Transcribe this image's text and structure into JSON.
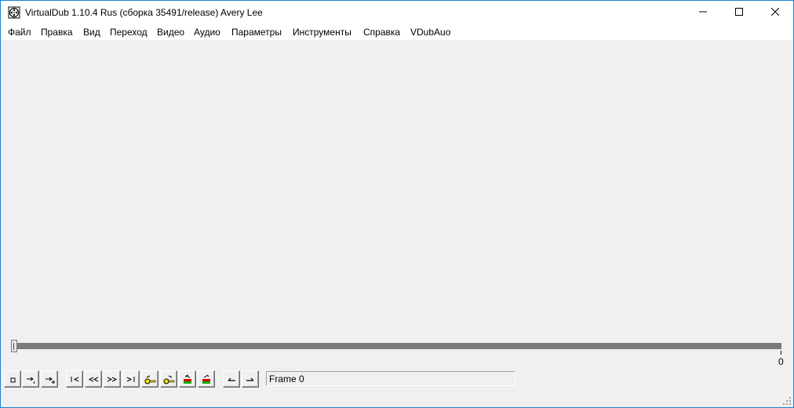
{
  "window": {
    "title": "VirtualDub 1.10.4 Rus (сборка 35491/release) Avery Lee",
    "app_icon": "virtualdub-reel-icon",
    "accent_border": "#1883d7"
  },
  "caption_buttons": {
    "minimize_icon": "minimize-icon",
    "maximize_icon": "maximize-icon",
    "close_icon": "close-icon"
  },
  "menu": [
    "Файл",
    "Правка",
    "Вид",
    "Переход",
    "Видео",
    "Аудио",
    "Параметры",
    "Инструменты",
    "Справка",
    "VDubAuo"
  ],
  "timeline": {
    "position_frame": 0,
    "end_label": "0",
    "track_color": "#7b7b7b"
  },
  "toolbar": {
    "buttons": [
      "stop-icon",
      "play-input-icon",
      "play-output-icon",
      "go-start-icon",
      "step-back-icon",
      "step-forward-icon",
      "go-end-icon",
      "prev-keyframe-icon",
      "next-keyframe-icon",
      "prev-scene-icon",
      "next-scene-icon",
      "mark-in-icon",
      "mark-out-icon"
    ]
  },
  "status": {
    "frame_text": "Frame 0"
  }
}
